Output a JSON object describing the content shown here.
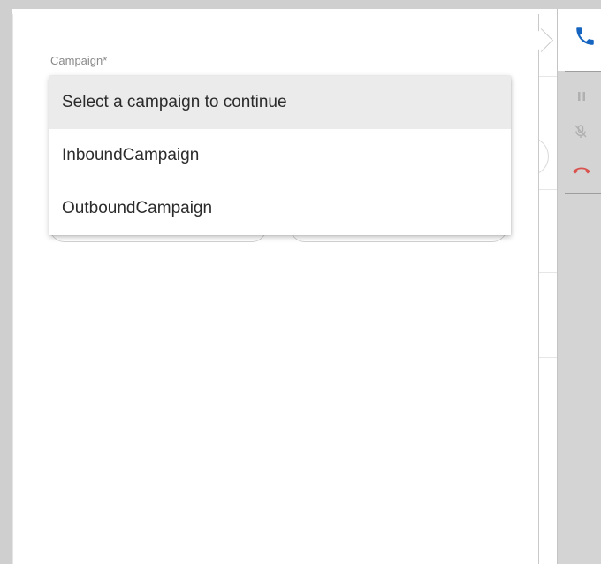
{
  "form": {
    "campaign_label": "Campaign*"
  },
  "dropdown": {
    "options": [
      {
        "label": "Select a campaign to continue",
        "highlighted": true
      },
      {
        "label": "InboundCampaign",
        "highlighted": false
      },
      {
        "label": "OutboundCampaign",
        "highlighted": false
      }
    ]
  },
  "side_toolbar": {
    "icons": [
      "phone-icon",
      "pause-icon",
      "mute-microphone-icon",
      "hang-up-icon"
    ],
    "colors": {
      "phone": "#1565c0",
      "hang_up": "#d9534f",
      "muted": "#b0b0b0"
    }
  }
}
